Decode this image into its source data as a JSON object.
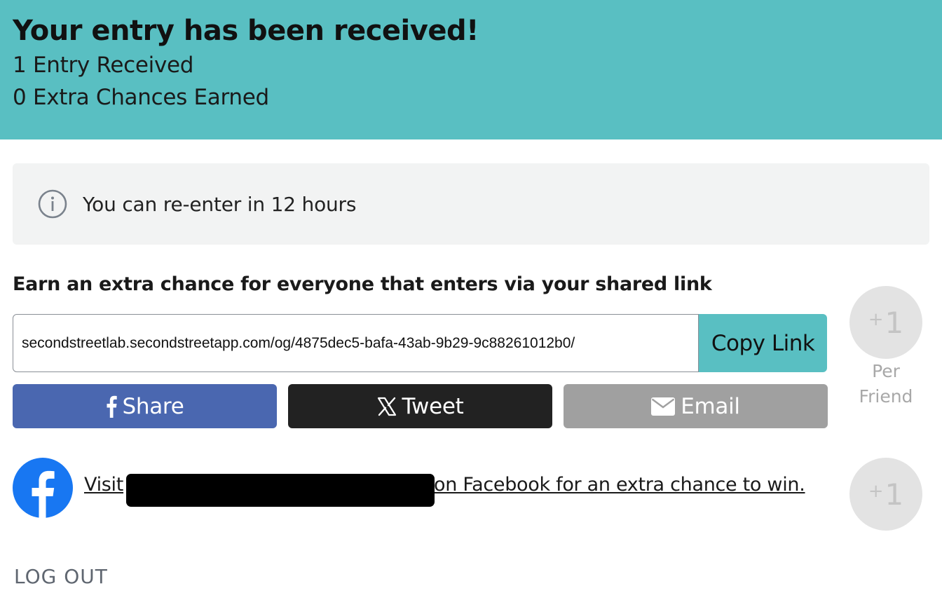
{
  "banner": {
    "title": "Your entry has been received!",
    "entries": "1 Entry Received",
    "extra_chances": "0 Extra Chances Earned",
    "background_color": "#59bfc2"
  },
  "notice": {
    "icon": "info-icon",
    "text": "You can re-enter in 12 hours"
  },
  "share": {
    "heading": "Earn an extra chance for everyone that enters via your shared link",
    "link_value": "secondstreetlab.secondstreetapp.com/og/4875dec5-bafa-43ab-9b29-9c88261012b0/",
    "copy_label": "Copy Link",
    "facebook_label": "Share",
    "x_label": "Tweet",
    "email_label": "Email",
    "facebook_color": "#4a67b0",
    "x_color": "#222222",
    "email_color": "#a0a0a0"
  },
  "badges": {
    "per_friend_plus": "+",
    "per_friend_value": "1",
    "per_friend_label_1": "Per",
    "per_friend_label_2": "Friend",
    "facebook_plus": "+",
    "facebook_value": "1"
  },
  "facebook_visit": {
    "prefix": "Visit",
    "suffix": "on Facebook for an extra chance to win.",
    "icon": "facebook-logo-icon"
  },
  "footer": {
    "logout_label": "LOG OUT"
  }
}
